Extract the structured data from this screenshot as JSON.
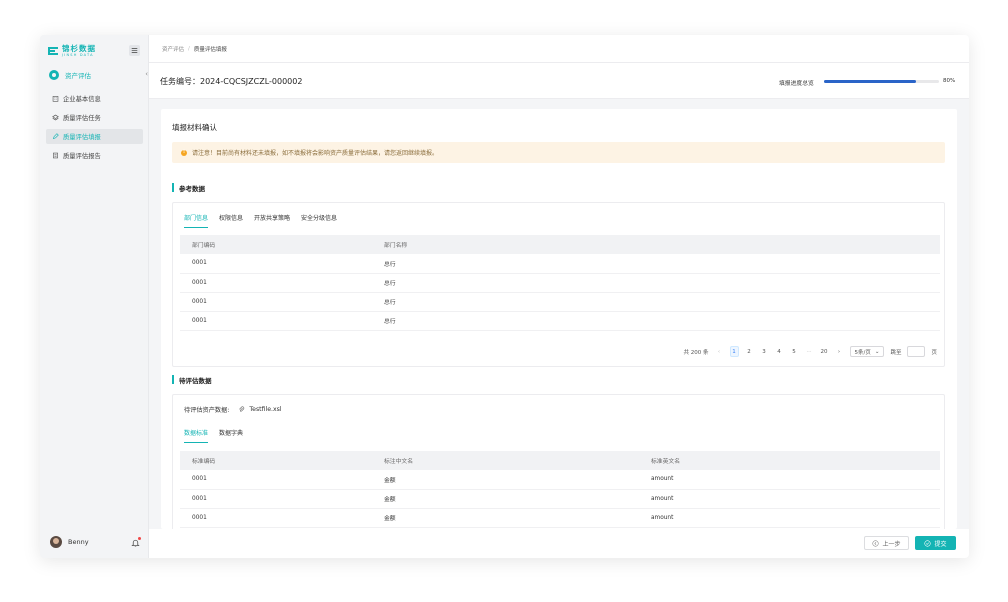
{
  "brand": {
    "name_cn": "锦杉数据",
    "name_en": "JINSH DATA",
    "color": "#14b4b4"
  },
  "sidebar": {
    "parent": {
      "label": "资产评估",
      "icon": "asset-icon"
    },
    "items": [
      {
        "label": "企业基本信息",
        "icon": "building-icon",
        "active": false
      },
      {
        "label": "质量评估任务",
        "icon": "layers-icon",
        "active": false
      },
      {
        "label": "质量评估填报",
        "icon": "edit-icon",
        "active": true
      },
      {
        "label": "质量评估报告",
        "icon": "report-icon",
        "active": false
      }
    ],
    "user": {
      "name": "Benny"
    }
  },
  "breadcrumb": {
    "parent": "资产评估",
    "separator": "/",
    "current": "质量评估填报"
  },
  "task": {
    "title": "任务编号：2024-CQCSJZCZL-000002",
    "progress_label": "填报进度总览",
    "progress_value": 0.8,
    "progress_text": "80%",
    "progress_color": "#2a64c8"
  },
  "main": {
    "section_title": "填报材料确认",
    "alert": "请注意！目前尚有材料还未填报，如不填报将会影响资产质量评估结果，请您返回继续填报。",
    "reference": {
      "title": "参考数据",
      "tabs": [
        "部门信息",
        "权限信息",
        "开放共享策略",
        "安全分级信息"
      ],
      "columns": [
        "部门编码",
        "部门名称"
      ],
      "rows": [
        [
          "0001",
          "总行"
        ],
        [
          "0001",
          "总行"
        ],
        [
          "0001",
          "总行"
        ],
        [
          "0001",
          "总行"
        ]
      ],
      "pagination": {
        "total": "共 200 条",
        "pages": [
          "1",
          "2",
          "3",
          "4",
          "5"
        ],
        "ellipsis": "···",
        "last": "20",
        "page_size": "5条/页",
        "jump_label": "跳至",
        "page_suffix": "页",
        "prev": "‹",
        "next": "›"
      }
    },
    "evaluate": {
      "title": "待评估数据",
      "file_label": "待评估资产数据:",
      "file_name": "Testfile.xsl",
      "tabs": [
        "数据标准",
        "数据字典"
      ],
      "columns": [
        "标准编码",
        "标注中文名",
        "标准英文名"
      ],
      "rows": [
        [
          "0001",
          "金额",
          "amount"
        ],
        [
          "0001",
          "金额",
          "amount"
        ],
        [
          "0001",
          "金额",
          "amount"
        ]
      ]
    }
  },
  "footer": {
    "prev_label": "上一步",
    "submit_label": "提交"
  }
}
